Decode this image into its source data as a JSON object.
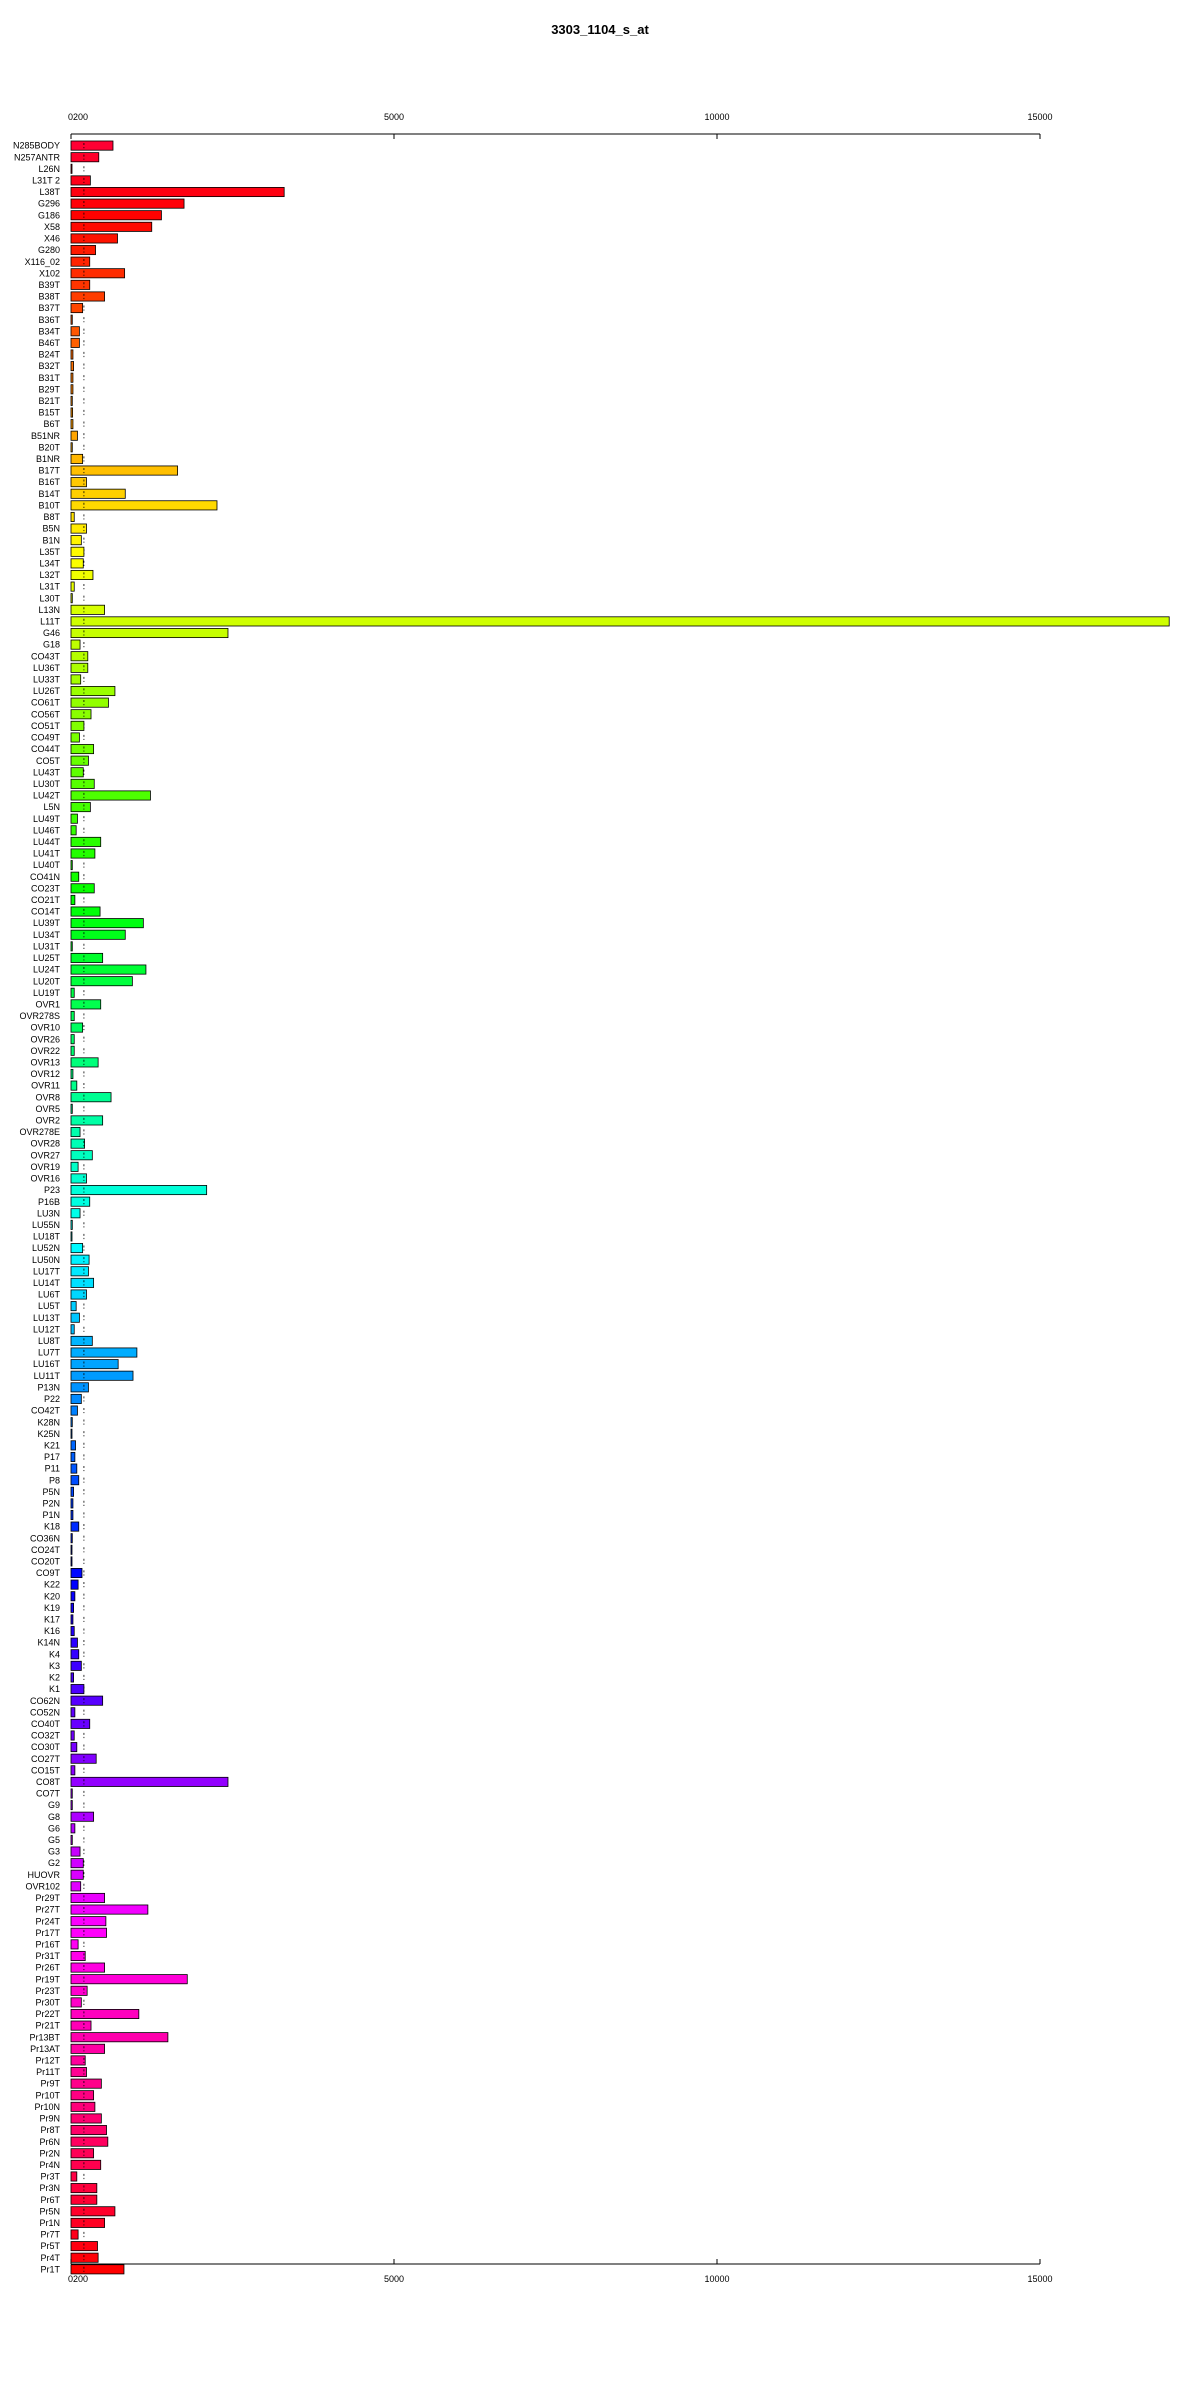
{
  "chart_data": {
    "type": "bar",
    "orientation": "horizontal",
    "title": "3303_1104_s_at",
    "xlabel": "",
    "ylabel": "",
    "xlim": [
      0,
      15000
    ],
    "x_ticks": [
      "0200",
      "5000",
      "10000",
      "15000"
    ],
    "x_tick_values": [
      0,
      5000,
      10000,
      15000
    ],
    "reference_line": 200,
    "grid": false,
    "legend": "none",
    "categories": [
      "N285BODY",
      "N257ANTR",
      "L26N",
      "L31T 2",
      "L38T",
      "G296",
      "G186",
      "X58",
      "X46",
      "G280",
      "X116_02",
      "X102",
      "B39T",
      "B38T",
      "B37T",
      "B36T",
      "B34T",
      "B46T",
      "B24T",
      "B32T",
      "B31T",
      "B29T",
      "B21T",
      "B15T",
      "B6T",
      "B51NR",
      "B20T",
      "B1NR",
      "B17T",
      "B16T",
      "B14T",
      "B10T",
      "B8T",
      "B5N",
      "B1N",
      "L35T",
      "L34T",
      "L32T",
      "L31T",
      "L30T",
      "L13N",
      "L11T",
      "G46",
      "G18",
      "CO43T",
      "LU36T",
      "LU33T",
      "LU26T",
      "CO61T",
      "CO56T",
      "CO51T",
      "CO49T",
      "CO44T",
      "CO5T",
      "LU43T",
      "LU30T",
      "LU42T",
      "L5N",
      "LU49T",
      "LU46T",
      "LU44T",
      "LU41T",
      "LU40T",
      "CO41N",
      "CO23T",
      "CO21T",
      "CO14T",
      "LU39T",
      "LU34T",
      "LU31T",
      "LU25T",
      "LU24T",
      "LU20T",
      "LU19T",
      "OVR1",
      "OVR278S",
      "OVR10",
      "OVR26",
      "OVR22",
      "OVR13",
      "OVR12",
      "OVR11",
      "OVR8",
      "OVR5",
      "OVR2",
      "OVR278E",
      "OVR28",
      "OVR27",
      "OVR19",
      "OVR16",
      "P23",
      "P16B",
      "LU3N",
      "LU55N",
      "LU18T",
      "LU52N",
      "LU50N",
      "LU17T",
      "LU14T",
      "LU6T",
      "LU5T",
      "LU13T",
      "LU12T",
      "LU8T",
      "LU7T",
      "LU16T",
      "LU11T",
      "P13N",
      "P22",
      "CO42T",
      "K28N",
      "K25N",
      "K21",
      "P17",
      "P11",
      "P8",
      "P5N",
      "P2N",
      "P1N",
      "K18",
      "CO36N",
      "CO24T",
      "CO20T",
      "CO9T",
      "K22",
      "K20",
      "K19",
      "K17",
      "K16",
      "K14N",
      "K4",
      "K3",
      "K2",
      "K1",
      "CO62N",
      "CO52N",
      "CO40T",
      "CO32T",
      "CO30T",
      "CO27T",
      "CO15T",
      "CO8T",
      "CO7T",
      "G9",
      "G8",
      "G6",
      "G5",
      "G3",
      "G2",
      "HUOVR",
      "OVR102",
      "Pr29T",
      "Pr27T",
      "Pr24T",
      "Pr17T",
      "Pr16T",
      "Pr31T",
      "Pr26T",
      "Pr19T",
      "Pr23T",
      "Pr30T",
      "Pr22T",
      "Pr21T",
      "Pr13BT",
      "Pr13AT",
      "Pr12T",
      "Pr11T",
      "Pr9T",
      "Pr10T",
      "Pr10N",
      "Pr9N",
      "Pr8T",
      "Pr6N",
      "Pr2N",
      "Pr4N",
      "Pr3T",
      "Pr3N",
      "Pr6T",
      "Pr5N",
      "Pr1N",
      "Pr7T",
      "Pr5T",
      "Pr4T",
      "Pr1T"
    ],
    "values": [
      650,
      430,
      10,
      300,
      3300,
      1750,
      1400,
      1250,
      720,
      380,
      290,
      830,
      290,
      520,
      180,
      20,
      130,
      130,
      30,
      40,
      30,
      30,
      20,
      25,
      30,
      100,
      20,
      180,
      1650,
      240,
      840,
      2260,
      50,
      240,
      160,
      200,
      190,
      340,
      50,
      20,
      520,
      17000,
      2430,
      140,
      260,
      260,
      150,
      680,
      580,
      310,
      200,
      130,
      350,
      270,
      190,
      360,
      1230,
      300,
      100,
      80,
      460,
      370,
      20,
      120,
      360,
      60,
      450,
      1120,
      840,
      20,
      490,
      1160,
      950,
      50,
      460,
      50,
      180,
      50,
      50,
      420,
      30,
      90,
      620,
      20,
      490,
      140,
      210,
      330,
      110,
      240,
      2100,
      290,
      140,
      20,
      10,
      180,
      280,
      270,
      350,
      240,
      80,
      130,
      50,
      330,
      1020,
      730,
      960,
      270,
      160,
      100,
      20,
      10,
      70,
      60,
      90,
      120,
      40,
      30,
      30,
      120,
      20,
      10,
      10,
      170,
      110,
      60,
      40,
      30,
      50,
      100,
      120,
      160,
      40,
      200,
      490,
      60,
      290,
      50,
      90,
      390,
      60,
      2430,
      20,
      20,
      350,
      60,
      20,
      140,
      190,
      190,
      150,
      520,
      1190,
      540,
      550,
      110,
      220,
      520,
      1800,
      250,
      160,
      1050,
      310,
      1500,
      520,
      220,
      240,
      470,
      350,
      370,
      470,
      550,
      570,
      350,
      460,
      90,
      400,
      400,
      680,
      520,
      110,
      410,
      420,
      820
    ]
  }
}
